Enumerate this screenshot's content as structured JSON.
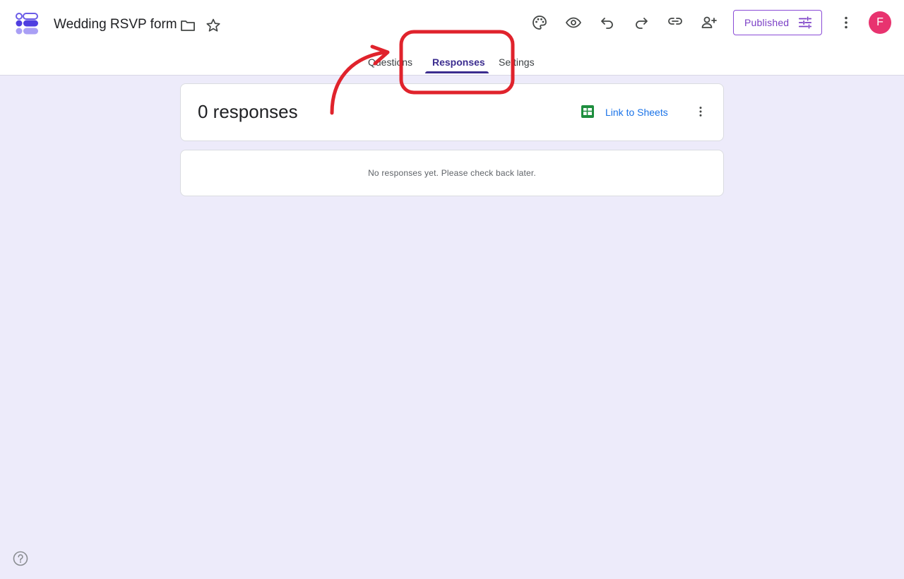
{
  "header": {
    "form_title": "Wedding RSVP form",
    "published_label": "Published",
    "avatar_letter": "F"
  },
  "icons": {
    "app_logo": "forms-logo-icon",
    "folder": "folder-icon",
    "star": "star-icon",
    "palette": "palette-icon",
    "preview": "eye-icon",
    "undo": "undo-icon",
    "redo": "redo-icon",
    "link": "link-icon",
    "add_collaborator": "person-add-icon",
    "tune": "tune-icon",
    "more": "more-vert-icon",
    "sheets": "sheets-icon",
    "help": "help-icon"
  },
  "tabs": [
    {
      "label": "Questions",
      "active": false
    },
    {
      "label": "Responses",
      "active": true
    },
    {
      "label": "Settings",
      "active": false
    }
  ],
  "summary": {
    "response_count": "0 responses",
    "link_sheets_label": "Link to Sheets"
  },
  "empty_state": {
    "message": "No responses yet. Please check back later."
  },
  "colors": {
    "page_background": "#edebfa",
    "accent": "#3b2c8f",
    "published": "#7b3fc6",
    "avatar": "#e8336f",
    "link": "#1a73e8",
    "annotation": "#e0232c"
  }
}
